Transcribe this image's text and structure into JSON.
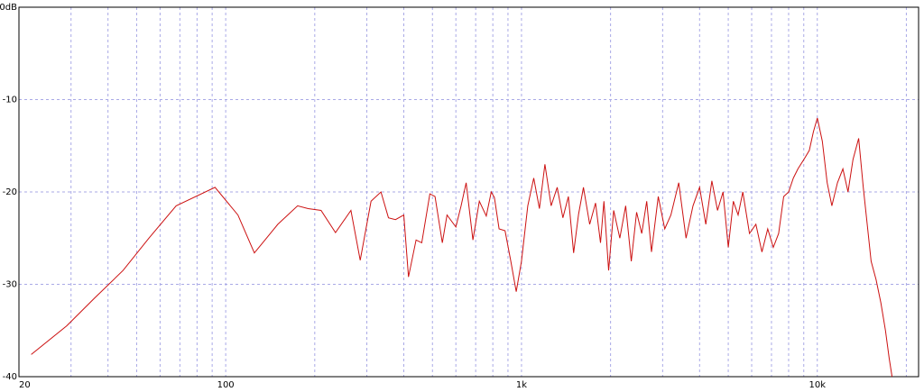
{
  "chart_data": {
    "type": "line",
    "title": "",
    "xlabel": "",
    "ylabel": "",
    "x_scale": "log",
    "xlim": [
      20,
      22000
    ],
    "ylim": [
      -40,
      0
    ],
    "grid": true,
    "legend": "none",
    "x_tick_labels": [
      {
        "value": 20,
        "label": "20"
      },
      {
        "value": 100,
        "label": "100"
      },
      {
        "value": 1000,
        "label": "1k"
      },
      {
        "value": 10000,
        "label": "10k"
      }
    ],
    "y_tick_labels": [
      {
        "value": 0,
        "label": "0dB"
      },
      {
        "value": -10,
        "label": "-10"
      },
      {
        "value": -20,
        "label": "-20"
      },
      {
        "value": -30,
        "label": "-30"
      },
      {
        "value": -40,
        "label": "-40"
      }
    ],
    "colors": {
      "series": "#cc1111",
      "grid": "#a9a9e6",
      "frame": "#000000",
      "background": "#ffffff"
    },
    "series": [
      {
        "x": [
          22,
          29,
          36,
          45,
          55,
          68,
          92,
          110,
          125,
          150,
          175,
          190,
          210,
          235,
          265,
          285,
          310,
          335,
          355,
          375,
          400,
          415,
          440,
          460,
          490,
          510,
          540,
          560,
          600,
          625,
          650,
          685,
          720,
          760,
          790,
          810,
          840,
          880,
          920,
          960,
          1000,
          1050,
          1100,
          1150,
          1200,
          1260,
          1320,
          1380,
          1440,
          1500,
          1560,
          1620,
          1700,
          1780,
          1850,
          1900,
          1970,
          2050,
          2150,
          2250,
          2350,
          2450,
          2550,
          2650,
          2750,
          2900,
          3050,
          3200,
          3400,
          3600,
          3800,
          4000,
          4200,
          4400,
          4600,
          4800,
          5000,
          5200,
          5400,
          5600,
          5900,
          6200,
          6500,
          6800,
          7100,
          7400,
          7700,
          8000,
          8300,
          8600,
          9000,
          9400,
          9700,
          10000,
          10400,
          10800,
          11200,
          11700,
          12200,
          12700,
          13200,
          13800,
          14300,
          14800,
          15200,
          15800,
          16400,
          17000,
          17500,
          17900
        ],
        "y": [
          -37.6,
          -34.5,
          -31.5,
          -28.5,
          -25.0,
          -21.5,
          -19.5,
          -22.5,
          -26.6,
          -23.5,
          -21.5,
          -21.8,
          -22.0,
          -24.4,
          -22.0,
          -27.4,
          -21.0,
          -20.0,
          -22.8,
          -23.0,
          -22.5,
          -29.2,
          -25.2,
          -25.5,
          -20.2,
          -20.5,
          -25.5,
          -22.5,
          -23.8,
          -21.5,
          -19.0,
          -25.2,
          -21.0,
          -22.6,
          -20.0,
          -20.6,
          -24.0,
          -24.2,
          -27.5,
          -30.8,
          -27.5,
          -21.5,
          -18.5,
          -21.8,
          -17.0,
          -21.5,
          -19.5,
          -22.8,
          -20.5,
          -26.6,
          -22.4,
          -19.5,
          -23.5,
          -21.2,
          -25.5,
          -21.0,
          -28.5,
          -22.0,
          -25.0,
          -21.5,
          -27.5,
          -22.2,
          -24.5,
          -21.0,
          -26.5,
          -20.5,
          -24.0,
          -22.5,
          -19.0,
          -25.0,
          -21.5,
          -19.5,
          -23.5,
          -18.8,
          -22.0,
          -20.0,
          -26.0,
          -21.0,
          -22.5,
          -20.0,
          -24.5,
          -23.5,
          -26.5,
          -24.0,
          -26.0,
          -24.5,
          -20.5,
          -20.0,
          -18.5,
          -17.5,
          -16.5,
          -15.5,
          -13.5,
          -12.0,
          -14.5,
          -19.0,
          -21.5,
          -19.0,
          -17.5,
          -20.0,
          -16.5,
          -14.2,
          -19.5,
          -24.0,
          -27.5,
          -29.5,
          -32.0,
          -35.0,
          -38.0,
          -40.0
        ]
      }
    ]
  }
}
